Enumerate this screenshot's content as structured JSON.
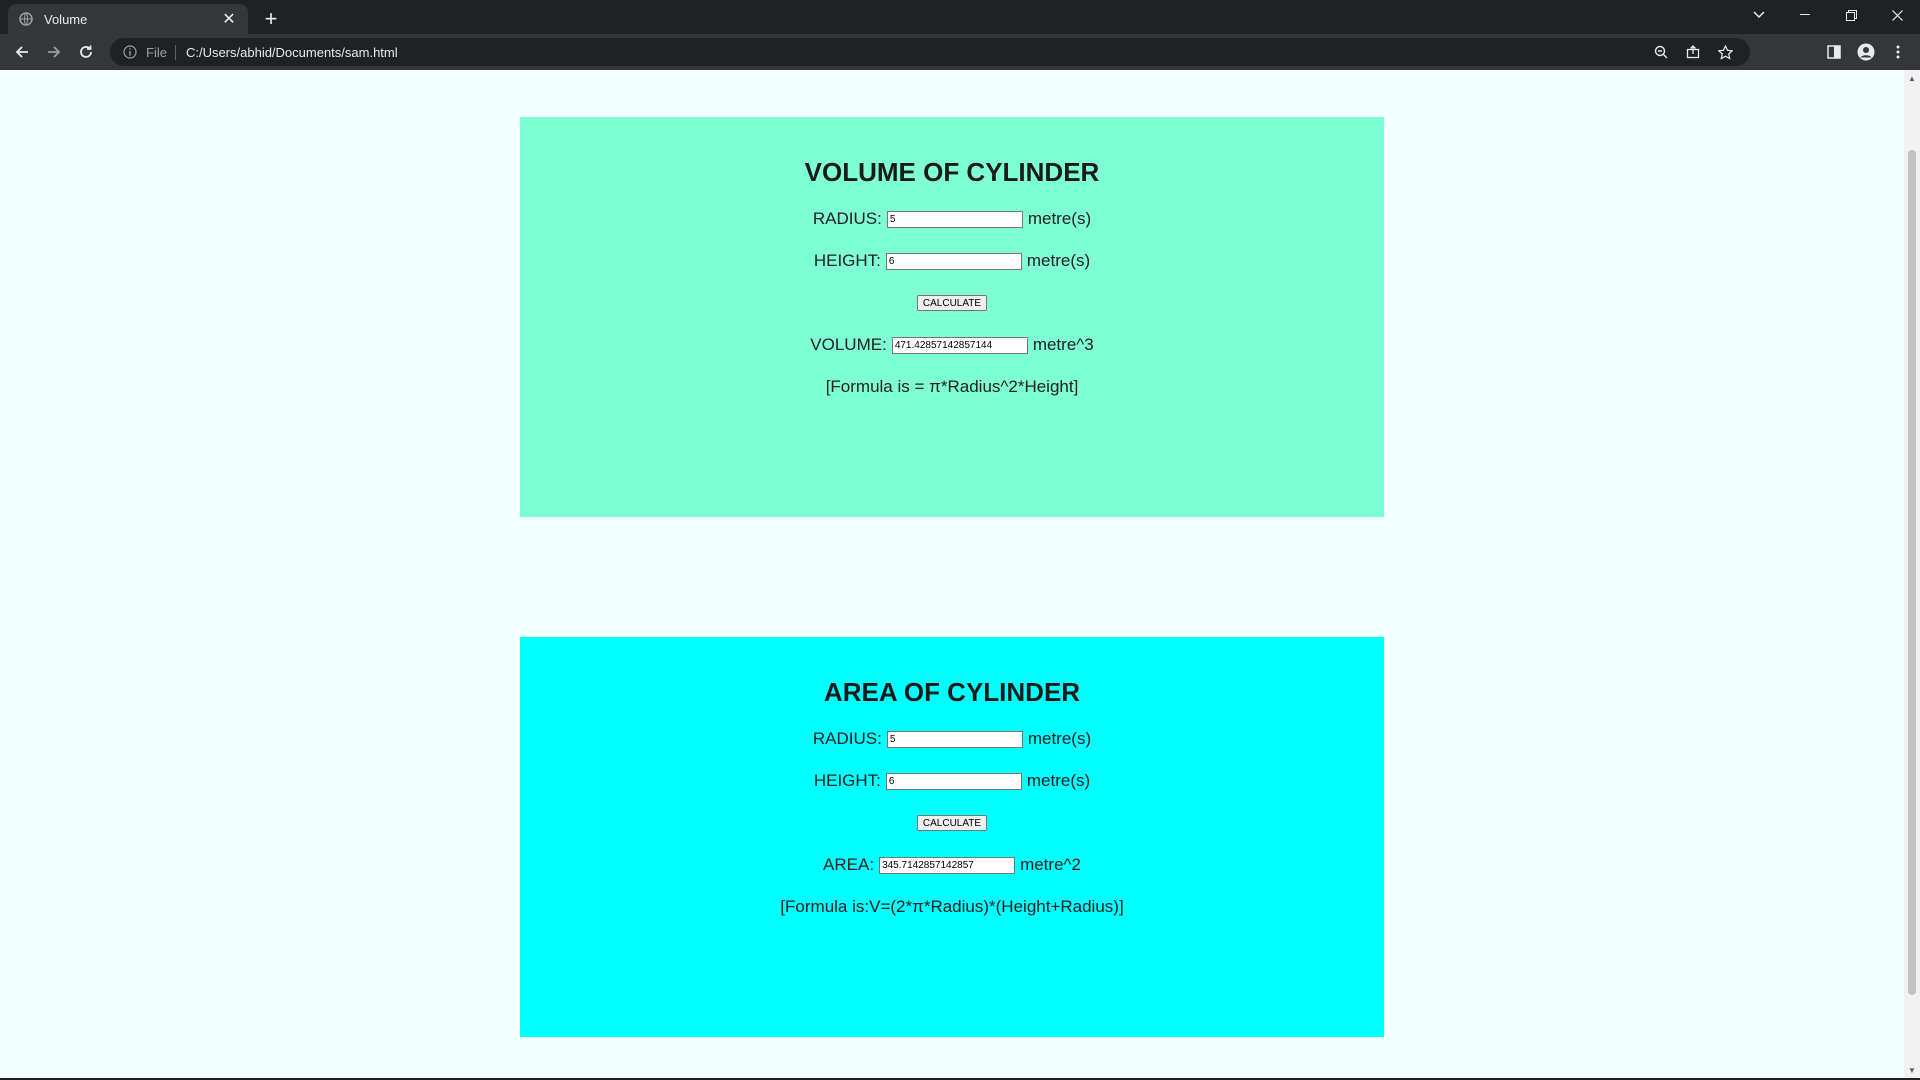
{
  "browser": {
    "tab_title": "Volume",
    "address_scheme": "File",
    "address_url": "C:/Users/abhid/Documents/sam.html"
  },
  "volume_panel": {
    "title": "VOLUME OF CYLINDER",
    "radius_label": "RADIUS:",
    "radius_value": "5",
    "radius_unit": "metre(s)",
    "height_label": "HEIGHT:",
    "height_value": "6",
    "height_unit": "metre(s)",
    "calculate_label": "CALCULATE",
    "result_label": "VOLUME:",
    "result_value": "471.42857142857144",
    "result_unit": "metre^3",
    "formula": "[Formula is = π*Radius^2*Height]"
  },
  "area_panel": {
    "title": "AREA OF CYLINDER",
    "radius_label": "RADIUS:",
    "radius_value": "5",
    "radius_unit": "metre(s)",
    "height_label": "HEIGHT:",
    "height_value": "6",
    "height_unit": "metre(s)",
    "calculate_label": "CALCULATE",
    "result_label": "AREA:",
    "result_value": "345.7142857142857",
    "result_unit": "metre^2",
    "formula": "[Formula is:V=(2*π*Radius)*(Height+Radius)]"
  },
  "colors": {
    "volume_bg": "#7fffd4",
    "area_bg": "#00ffff",
    "page_bg": "#f0ffff"
  }
}
